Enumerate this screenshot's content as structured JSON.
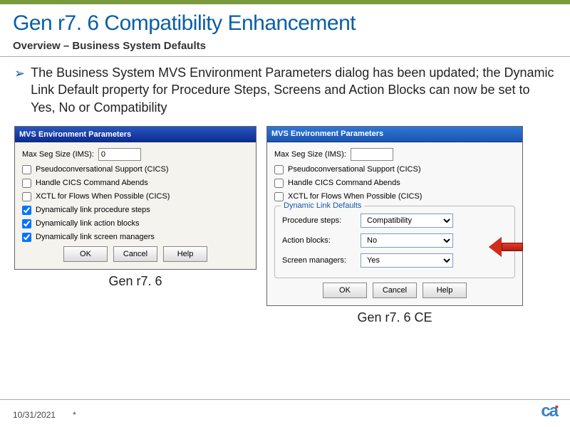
{
  "title": "Gen r7. 6 Compatibility Enhancement",
  "subtitle": "Overview – Business System Defaults",
  "bullet": "The Business System MVS Environment Parameters dialog has been updated; the Dynamic Link Default property for Procedure Steps, Screens and Action Blocks can now be set to Yes, No or Compatibility",
  "dlg_title": "MVS Environment Parameters",
  "max_seg_label": "Max Seg Size (IMS):",
  "max_seg_value_old": "0",
  "max_seg_value_new": "",
  "old_checks": [
    {
      "label": "Pseudoconversational Support (CICS)",
      "checked": false
    },
    {
      "label": "Handle CICS Command Abends",
      "checked": false
    },
    {
      "label": "XCTL for Flows When Possible (CICS)",
      "checked": false
    },
    {
      "label": "Dynamically link procedure steps",
      "checked": true
    },
    {
      "label": "Dynamically link action blocks",
      "checked": true
    },
    {
      "label": "Dynamically link screen managers",
      "checked": true
    }
  ],
  "new_checks": [
    {
      "label": "Pseudoconversational Support (CICS)",
      "checked": false
    },
    {
      "label": "Handle CICS Command Abends",
      "checked": false
    },
    {
      "label": "XCTL for Flows When Possible (CICS)",
      "checked": false
    }
  ],
  "group_title": "Dynamic Link Defaults",
  "combos": [
    {
      "label": "Procedure steps:",
      "value": "Compatibility"
    },
    {
      "label": "Action blocks:",
      "value": "No"
    },
    {
      "label": "Screen managers:",
      "value": "Yes"
    }
  ],
  "buttons": {
    "ok": "OK",
    "cancel": "Cancel",
    "help": "Help"
  },
  "caption_old": "Gen r7. 6",
  "caption_new": "Gen r7. 6 CE",
  "footer_date": "10/31/2021",
  "footer_mark": "*",
  "logo": "ca"
}
